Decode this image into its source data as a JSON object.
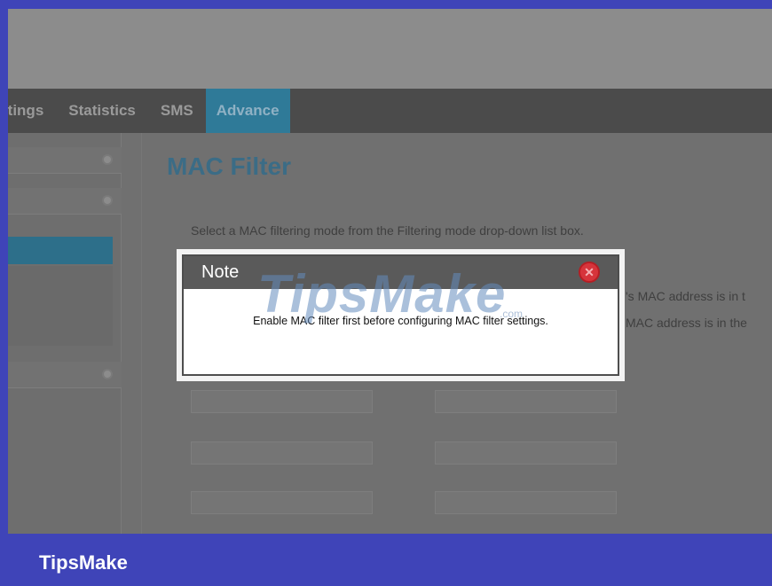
{
  "nav": {
    "items": [
      {
        "label": "ttings"
      },
      {
        "label": "Statistics"
      },
      {
        "label": "SMS"
      },
      {
        "label": "Advance"
      }
    ]
  },
  "page": {
    "title": "MAC Filter",
    "description": "Select a MAC filtering mode from the Filtering mode drop-down list box.",
    "desc_line2": "'s MAC address is in t",
    "desc_line3": "MAC address is in the"
  },
  "modal": {
    "title": "Note",
    "message": "Enable MAC filter first before configuring MAC filter settings.",
    "close_glyph": "✕"
  },
  "watermark": {
    "text": "TipsMake",
    "suffix": ".com"
  },
  "footer": {
    "brand": "TipsMake"
  },
  "colors": {
    "frame": "#3f44b8",
    "nav_active": "#2f7a98",
    "title": "#3b6c86",
    "close_button": "#d6343b"
  }
}
